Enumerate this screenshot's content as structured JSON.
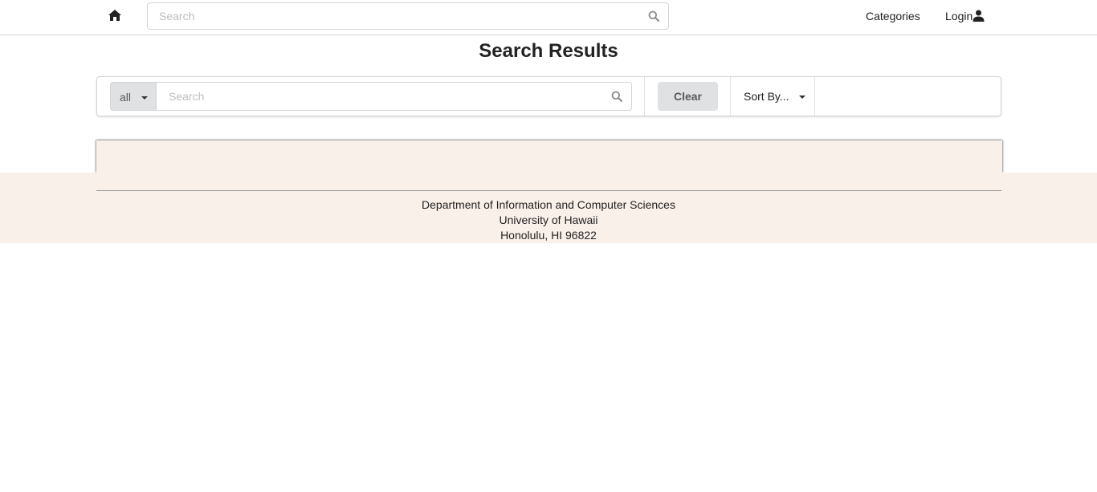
{
  "navbar": {
    "home_icon": "home-icon",
    "search_placeholder": "Search",
    "search_icon": "search-icon",
    "categories_label": "Categories",
    "login_label": "Login",
    "login_icon": "user-icon"
  },
  "page": {
    "title": "Search Results"
  },
  "filter_bar": {
    "scope_value": "all",
    "search_placeholder": "Search",
    "clear_label": "Clear",
    "sort_label": "Sort By..."
  },
  "footer": {
    "line1": "Department of Information and Computer Sciences",
    "line2": "University of Hawaii",
    "line3": "Honolulu, HI 96822"
  },
  "colors": {
    "footer_bg": "#faf0ea",
    "button_gray": "#e0e1e2",
    "border": "#d4d4d5"
  }
}
